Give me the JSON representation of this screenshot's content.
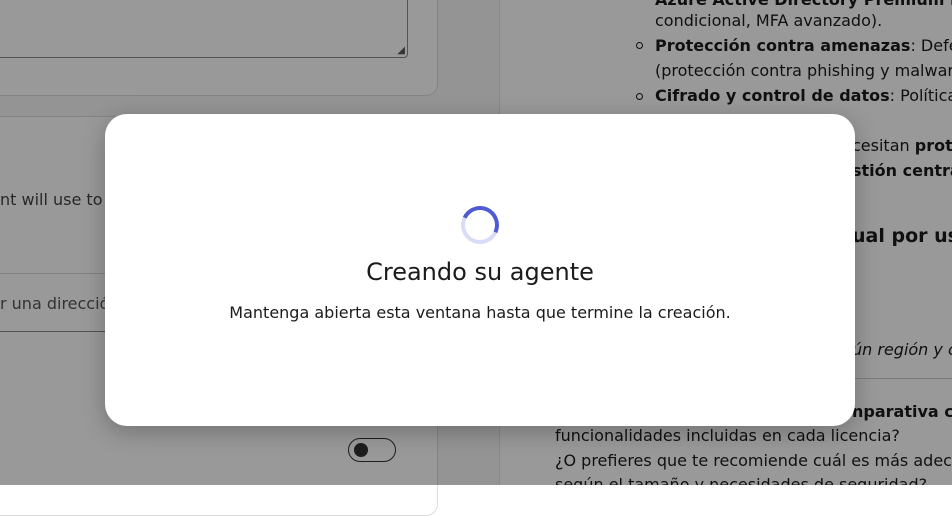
{
  "left_panel": {
    "description_partial": "nt will use to g",
    "address_placeholder": "r una direcció",
    "toggle_on": false
  },
  "right_panel": {
    "lines": [
      "Azure Active Directory Premium P",
      "condicional, MFA avanzado).",
      "Protección contra amenazas",
      ": Defend",
      "(protección contra phishing y malware)",
      "Cifrado y control de datos",
      ": Políticas d",
      "cesitan ",
      "prote",
      "stión central",
      "ual por usu",
      "ún región y co",
      "nparativa co",
      "funcionalidades incluidas en cada licencia?",
      "¿O prefieres que te recomiende cuál es más adecua",
      "según el tamaño y necesidades de seguridad?"
    ]
  },
  "modal": {
    "title": "Creando su agente",
    "subtitle": "Mantenga abierta esta ventana hasta que termine la creación.",
    "spinner_accent": "#4f5bd5"
  }
}
